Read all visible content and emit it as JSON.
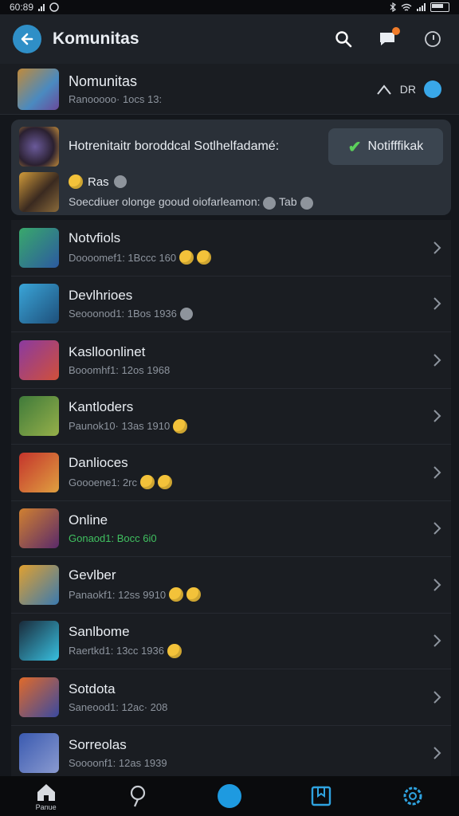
{
  "status_bar": {
    "time": "60:89"
  },
  "app_bar": {
    "title": "Komunitas",
    "back_icon": "arrow-left-icon",
    "actions": [
      "search-icon",
      "chat-bubble-icon",
      "info-icon"
    ]
  },
  "header": {
    "title": "Nomunitas",
    "subtitle": "Ranooooo· 1ocs 13:",
    "right_label": "DR"
  },
  "notification": {
    "line1": "Hotrenitaitr boroddcal Sotlhelfadamé:",
    "button_label": "Notifffikak",
    "line2_title": "Ras",
    "line2_text": "Soecdiuer olonge gooud oiofarleamon:",
    "line2_tag": "Tab"
  },
  "list": [
    {
      "title": "Notvfiols",
      "subtitle": "Doooomef1: 1Bccc 160",
      "colors": [
        "#39a86b",
        "#2c5aa0"
      ]
    },
    {
      "title": "Devlhrioes",
      "subtitle": "Seooonod1: 1Bos 1936",
      "colors": [
        "#3aa5d8",
        "#1e4f7a"
      ]
    },
    {
      "title": "Kaslloonlinet",
      "subtitle": "Booomhf1: 12os 1968",
      "colors": [
        "#8a3aa0",
        "#d0503a"
      ]
    },
    {
      "title": "Kantloders",
      "subtitle": "Paunok10· 13as 1910",
      "colors": [
        "#3f7a3a",
        "#96b04a"
      ]
    },
    {
      "title": "Danlioces",
      "subtitle": "Goooene1: 2rc",
      "colors": [
        "#c4342c",
        "#e0a040"
      ]
    },
    {
      "title": "Online",
      "subtitle": "Gonaod1: Bocc 6i0",
      "colors": [
        "#d08030",
        "#5a2a6a"
      ]
    },
    {
      "title": "Gevlber",
      "subtitle": "Panaokf1: 12ss 9910",
      "colors": [
        "#e0a030",
        "#3a7ab0"
      ]
    },
    {
      "title": "Sanlbome",
      "subtitle": "Raertkd1: 13cc 1936",
      "colors": [
        "#1a2a3a",
        "#38c0e0"
      ]
    },
    {
      "title": "Sotdota",
      "subtitle": "Saneood1: 12ac· 208",
      "colors": [
        "#e06a2a",
        "#3a4aa0"
      ]
    },
    {
      "title": "Sorreolas",
      "subtitle": "Soooonf1: 12as 1939",
      "colors": [
        "#3a5ab0",
        "#8a9ad0"
      ]
    }
  ],
  "bottom_nav": {
    "home_label": "Panue"
  }
}
